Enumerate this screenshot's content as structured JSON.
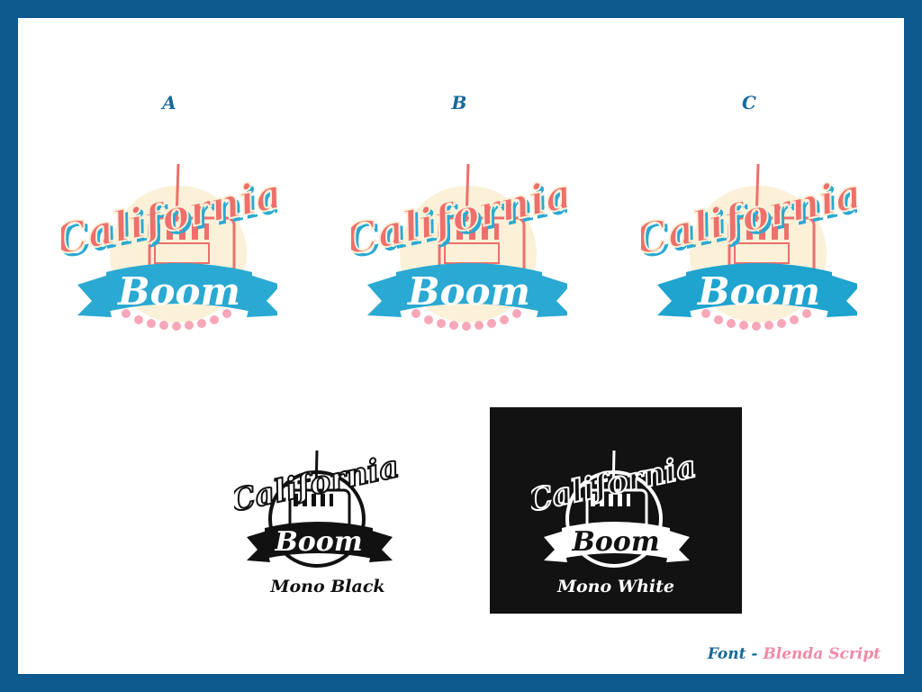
{
  "variants": [
    {
      "label": "A"
    },
    {
      "label": "B"
    },
    {
      "label": "C"
    }
  ],
  "logo_text": {
    "line1": "California",
    "line2": "Boom"
  },
  "mono": [
    {
      "label": "Mono Black"
    },
    {
      "label": "Mono White"
    }
  ],
  "font_credit": {
    "prefix": "Font -",
    "name": "Blenda Script"
  },
  "colors": {
    "frame": "#0d5a8e",
    "label_blue": "#17699b",
    "coral": "#ee6f6b",
    "cyan": "#2aa9d2",
    "cream": "#fbf1d8",
    "pink": "#f7a7b8",
    "panel_black": "#121212"
  }
}
